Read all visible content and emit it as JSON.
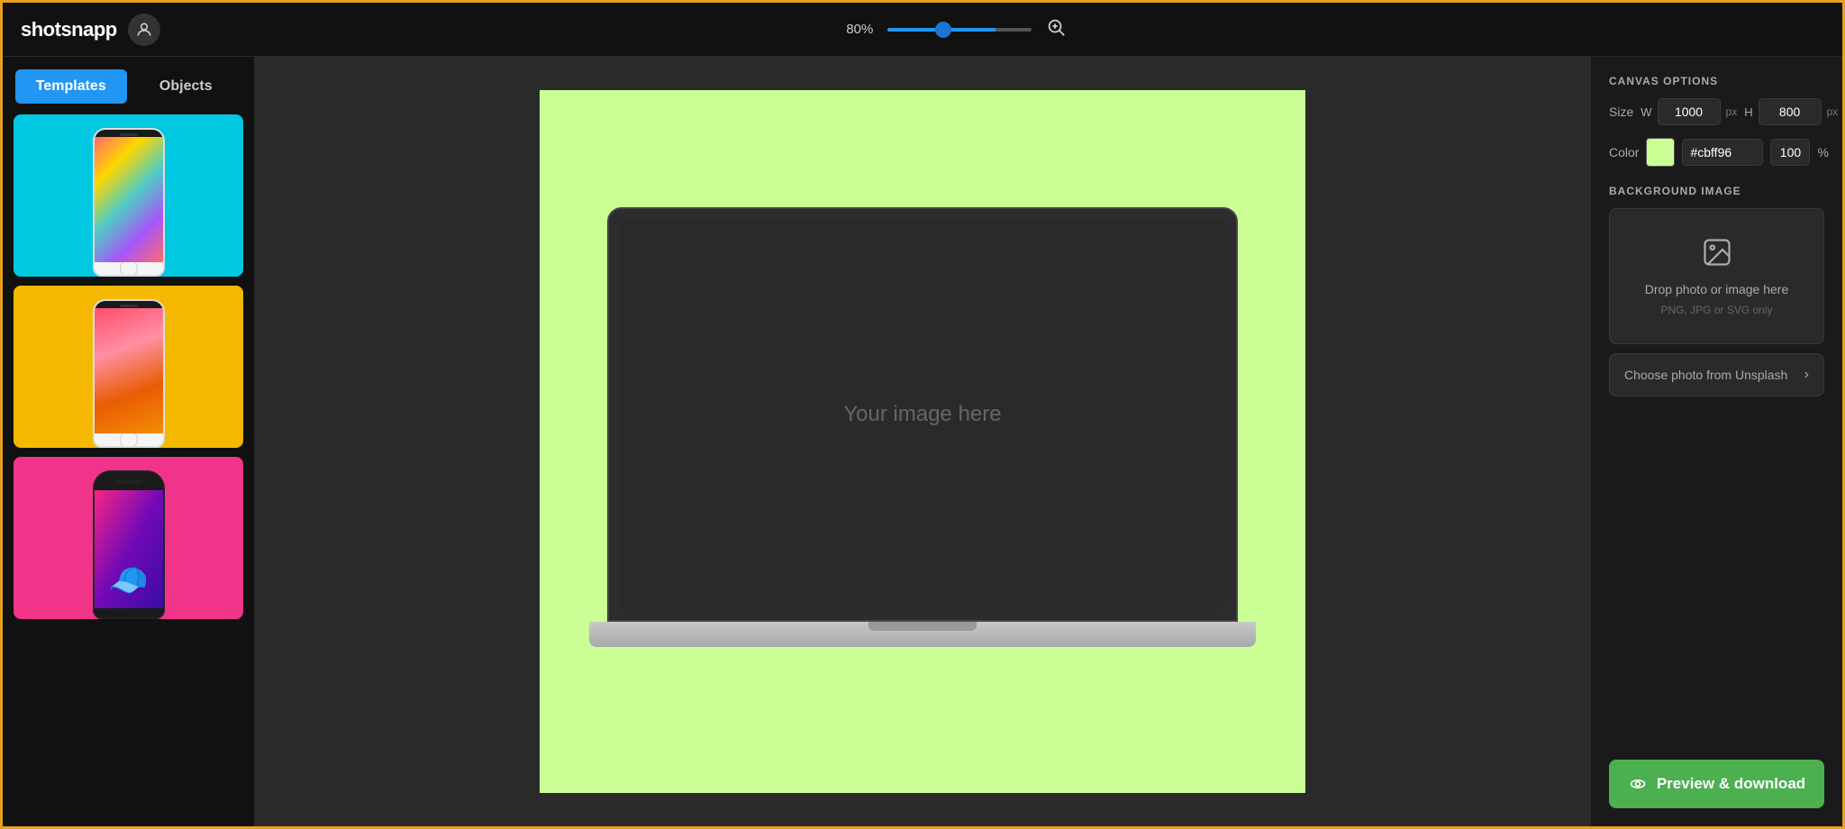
{
  "app": {
    "name": "shotsnapp",
    "avatar_label": "user"
  },
  "topbar": {
    "zoom_value": "80%",
    "zoom_icon": "⊕"
  },
  "sidebar": {
    "tab_templates": "Templates",
    "tab_objects": "Objects",
    "templates": [
      {
        "id": 1,
        "bg": "#00c8e0",
        "type": "phone-colorful"
      },
      {
        "id": 2,
        "bg": "#f5b800",
        "type": "phone-pink-smoke"
      },
      {
        "id": 3,
        "bg": "#f0348a",
        "type": "phone-character"
      }
    ]
  },
  "canvas": {
    "bg_color": "#cbff96",
    "image_placeholder": "Your image here"
  },
  "right_panel": {
    "title": "CANVAS OPTIONS",
    "size_label": "Size",
    "width_label": "W",
    "width_value": "1000",
    "width_unit": "px",
    "height_label": "H",
    "height_value": "800",
    "height_unit": "px",
    "color_label": "Color",
    "color_hex": "#cbff96",
    "opacity_value": "100",
    "opacity_unit": "%",
    "bg_image_title": "BACKGROUND IMAGE",
    "drop_zone_text": "Drop photo or image here",
    "drop_zone_subtext": "PNG, JPG or SVG only",
    "unsplash_label": "Choose photo from Unsplash",
    "preview_download_label": "Preview & download"
  }
}
